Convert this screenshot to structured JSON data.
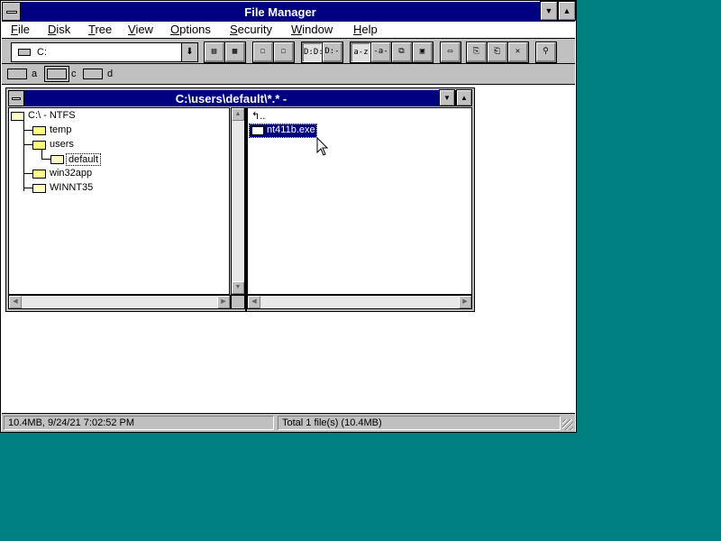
{
  "window": {
    "title": "File Manager"
  },
  "menu": [
    {
      "label": "File",
      "key": "F",
      "rest": "ile"
    },
    {
      "label": "Disk",
      "key": "D",
      "rest": "isk"
    },
    {
      "label": "Tree",
      "key": "T",
      "rest": "ree"
    },
    {
      "label": "View",
      "key": "V",
      "rest": "iew"
    },
    {
      "label": "Options",
      "key": "O",
      "rest": "ptions"
    },
    {
      "label": "Security",
      "key": "S",
      "rest": "ecurity"
    },
    {
      "label": "Window",
      "key": "W",
      "rest": "indow"
    },
    {
      "label": "Help",
      "key": "H",
      "rest": "elp"
    }
  ],
  "toolbar": {
    "drive_value": "C:",
    "buttons": [
      {
        "name": "connect-network-drive-button",
        "glyph": "▤"
      },
      {
        "name": "disconnect-network-drive-button",
        "glyph": "▦"
      },
      {
        "name": "share-as-button",
        "glyph": "☐"
      },
      {
        "name": "stop-sharing-button",
        "glyph": "☐"
      },
      {
        "name": "view-name-button",
        "glyph": "D:D:"
      },
      {
        "name": "view-details-button",
        "glyph": "D:--"
      },
      {
        "name": "sort-by-name-button",
        "glyph": "a-z"
      },
      {
        "name": "sort-by-type-button",
        "glyph": "-a-z"
      },
      {
        "name": "sort-by-size-button",
        "glyph": "⧉"
      },
      {
        "name": "sort-by-date-button",
        "glyph": "▣"
      },
      {
        "name": "new-window-button",
        "glyph": "▭"
      },
      {
        "name": "copy-button",
        "glyph": "⎘"
      },
      {
        "name": "move-button",
        "glyph": "⎗"
      },
      {
        "name": "delete-button",
        "glyph": "✕"
      },
      {
        "name": "properties-button",
        "glyph": "⚲"
      }
    ]
  },
  "drives": [
    {
      "letter": "a",
      "type": "floppy"
    },
    {
      "letter": "c",
      "type": "hard-disk",
      "selected": true
    },
    {
      "letter": "d",
      "type": "cdrom"
    }
  ],
  "child": {
    "title": "C:\\users\\default\\*.* -",
    "tree": [
      {
        "label": "C:\\ - NTFS",
        "depth": 0,
        "open": true
      },
      {
        "label": "temp",
        "depth": 1
      },
      {
        "label": "users",
        "depth": 1
      },
      {
        "label": "default",
        "depth": 2,
        "open": true,
        "selected": true
      },
      {
        "label": "win32app",
        "depth": 1
      },
      {
        "label": "WINNT35",
        "depth": 1,
        "open": true
      }
    ],
    "files": [
      {
        "label": "..",
        "type": "parent"
      },
      {
        "label": "nt411b.exe",
        "type": "exe",
        "selected": true
      }
    ]
  },
  "status": {
    "left": "10.4MB, 9/24/21 7:02:52 PM",
    "right": "Total 1 file(s) (10.4MB)"
  }
}
